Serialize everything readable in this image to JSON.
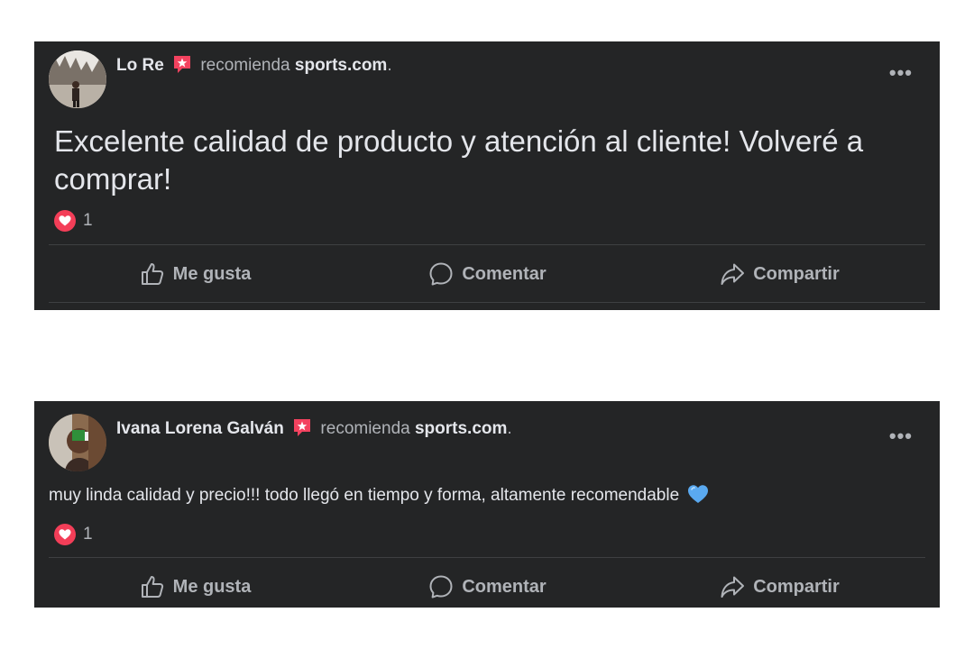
{
  "posts": [
    {
      "author": "Lo Re",
      "recommend_text": "recomienda",
      "brand": "sports.com",
      "period": ".",
      "more_label": "•••",
      "text": "Excelente calidad de producto y atención al cliente! Volveré a comprar!",
      "reaction_count": "1",
      "actions": {
        "like": "Me gusta",
        "comment": "Comentar",
        "share": "Compartir"
      }
    },
    {
      "author": "Ivana Lorena Galván",
      "recommend_text": "recomienda",
      "brand": "sports.com",
      "period": ".",
      "more_label": "•••",
      "text": "muy linda calidad y precio!!! todo llegó en tiempo y forma, altamente recomendable",
      "emoji": "blue-heart-emoji",
      "reaction_count": "1",
      "actions": {
        "like": "Me gusta",
        "comment": "Comentar",
        "share": "Compartir"
      }
    }
  ],
  "colors": {
    "card_bg": "#242526",
    "primary_text": "#e4e6eb",
    "secondary_text": "#b0b3b8",
    "divider": "#3e4042",
    "recommend_icon": "#f3425f",
    "love_reaction": "#f33e58",
    "blue_heart": "#5aa9f0"
  }
}
